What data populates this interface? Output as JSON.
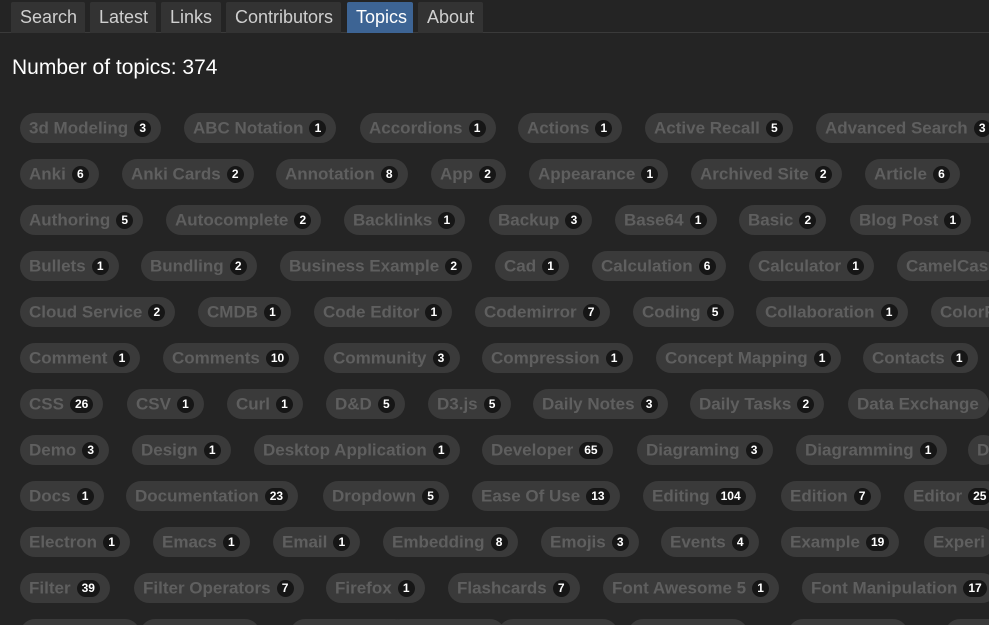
{
  "nav": {
    "tabs": [
      {
        "label": "Search"
      },
      {
        "label": "Latest"
      },
      {
        "label": "Links"
      },
      {
        "label": "Contributors"
      },
      {
        "label": "Topics",
        "active": true
      },
      {
        "label": "About"
      }
    ]
  },
  "summary": {
    "text": "Number of topics: 374"
  },
  "topic_rows": [
    [
      {
        "label": "3d Modeling",
        "count": "3"
      },
      {
        "label": "ABC Notation",
        "count": "1"
      },
      {
        "label": "Accordions",
        "count": "1"
      },
      {
        "label": "Actions",
        "count": "1"
      },
      {
        "label": "Active Recall",
        "count": "5"
      },
      {
        "label": "Advanced Search",
        "count": "3"
      }
    ],
    [
      {
        "label": "Anki",
        "count": "6"
      },
      {
        "label": "Anki Cards",
        "count": "2"
      },
      {
        "label": "Annotation",
        "count": "8"
      },
      {
        "label": "App",
        "count": "2"
      },
      {
        "label": "Appearance",
        "count": "1"
      },
      {
        "label": "Archived Site",
        "count": "2"
      },
      {
        "label": "Article",
        "count": "6"
      }
    ],
    [
      {
        "label": "Authoring",
        "count": "5"
      },
      {
        "label": "Autocomplete",
        "count": "2"
      },
      {
        "label": "Backlinks",
        "count": "1"
      },
      {
        "label": "Backup",
        "count": "3"
      },
      {
        "label": "Base64",
        "count": "1"
      },
      {
        "label": "Basic",
        "count": "2"
      },
      {
        "label": "Blog Post",
        "count": "1"
      }
    ],
    [
      {
        "label": "Bullets",
        "count": "1"
      },
      {
        "label": "Bundling",
        "count": "2"
      },
      {
        "label": "Business Example",
        "count": "2"
      },
      {
        "label": "Cad",
        "count": "1"
      },
      {
        "label": "Calculation",
        "count": "6"
      },
      {
        "label": "Calculator",
        "count": "1"
      },
      {
        "label": "CamelCas",
        "count": ""
      }
    ],
    [
      {
        "label": "Cloud Service",
        "count": "2"
      },
      {
        "label": "CMDB",
        "count": "1"
      },
      {
        "label": "Code Editor",
        "count": "1"
      },
      {
        "label": "Codemirror",
        "count": "7"
      },
      {
        "label": "Coding",
        "count": "5"
      },
      {
        "label": "Collaboration",
        "count": "1"
      },
      {
        "label": "ColorF",
        "count": ""
      }
    ],
    [
      {
        "label": "Comment",
        "count": "1"
      },
      {
        "label": "Comments",
        "count": "10"
      },
      {
        "label": "Community",
        "count": "3"
      },
      {
        "label": "Compression",
        "count": "1"
      },
      {
        "label": "Concept Mapping",
        "count": "1"
      },
      {
        "label": "Contacts",
        "count": "1"
      }
    ],
    [
      {
        "label": "CSS",
        "count": "26"
      },
      {
        "label": "CSV",
        "count": "1"
      },
      {
        "label": "Curl",
        "count": "1"
      },
      {
        "label": "D&D",
        "count": "5"
      },
      {
        "label": "D3.js",
        "count": "5"
      },
      {
        "label": "Daily Notes",
        "count": "3"
      },
      {
        "label": "Daily Tasks",
        "count": "2"
      },
      {
        "label": "Data Exchange",
        "count": ""
      }
    ],
    [
      {
        "label": "Demo",
        "count": "3"
      },
      {
        "label": "Design",
        "count": "1"
      },
      {
        "label": "Desktop Application",
        "count": "1"
      },
      {
        "label": "Developer",
        "count": "65"
      },
      {
        "label": "Diagraming",
        "count": "3"
      },
      {
        "label": "Diagramming",
        "count": "1"
      },
      {
        "label": "D",
        "count": ""
      }
    ],
    [
      {
        "label": "Docs",
        "count": "1"
      },
      {
        "label": "Documentation",
        "count": "23"
      },
      {
        "label": "Dropdown",
        "count": "5"
      },
      {
        "label": "Ease Of Use",
        "count": "13"
      },
      {
        "label": "Editing",
        "count": "104"
      },
      {
        "label": "Edition",
        "count": "7"
      },
      {
        "label": "Editor",
        "count": "25"
      }
    ],
    [
      {
        "label": "Electron",
        "count": "1"
      },
      {
        "label": "Emacs",
        "count": "1"
      },
      {
        "label": "Email",
        "count": "1"
      },
      {
        "label": "Embedding",
        "count": "8"
      },
      {
        "label": "Emojis",
        "count": "3"
      },
      {
        "label": "Events",
        "count": "4"
      },
      {
        "label": "Example",
        "count": "19"
      },
      {
        "label": "Experi",
        "count": ""
      }
    ],
    [
      {
        "label": "Filter",
        "count": "39"
      },
      {
        "label": "Filter Operators",
        "count": "7"
      },
      {
        "label": "Firefox",
        "count": "1"
      },
      {
        "label": "Flashcards",
        "count": "7"
      },
      {
        "label": "Font Awesome 5",
        "count": "1"
      },
      {
        "label": "Font Manipulation",
        "count": "17"
      }
    ],
    [
      {
        "label": "",
        "count": ""
      },
      {
        "label": "",
        "count": ""
      },
      {
        "label": "",
        "count": ""
      },
      {
        "label": "",
        "count": ""
      },
      {
        "label": "",
        "count": ""
      },
      {
        "label": "",
        "count": ""
      },
      {
        "label": "",
        "count": ""
      },
      {
        "label": "",
        "count": ""
      }
    ]
  ]
}
